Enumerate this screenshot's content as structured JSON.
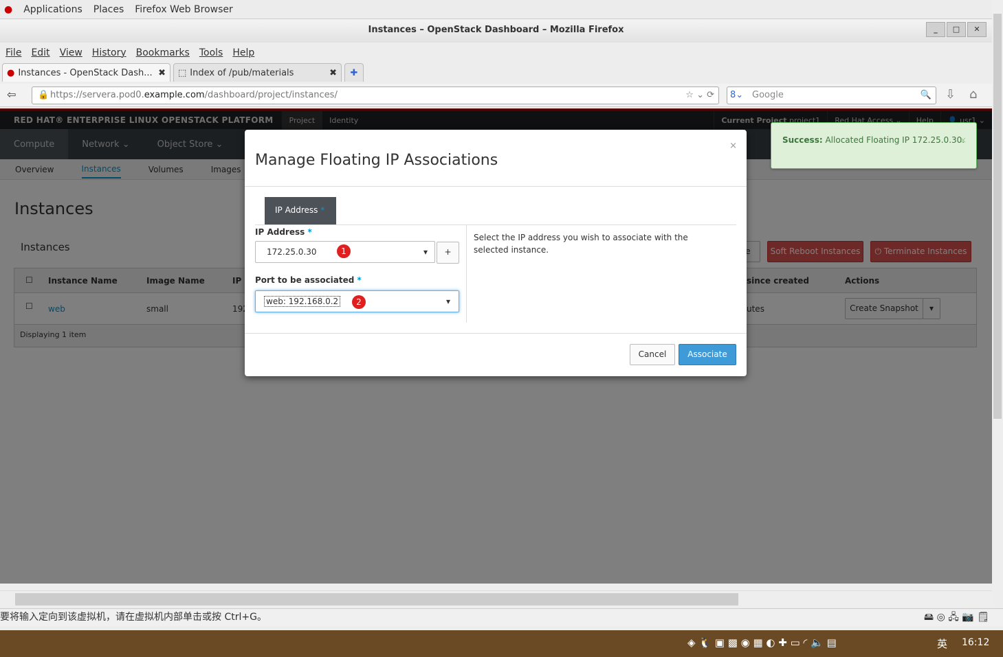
{
  "gnome": {
    "applications": "Applications",
    "places": "Places",
    "firefox": "Firefox Web Browser"
  },
  "window": {
    "title": "Instances – OpenStack Dashboard – Mozilla Firefox"
  },
  "menu": [
    "File",
    "Edit",
    "View",
    "History",
    "Bookmarks",
    "Tools",
    "Help"
  ],
  "tabs": [
    {
      "label": "Instances - OpenStack Dash..."
    },
    {
      "label": "Index of /pub/materials"
    }
  ],
  "url": {
    "pre": "https://servera.pod0.",
    "host": "example.com",
    "post": "/dashboard/project/instances/"
  },
  "search": {
    "placeholder": "Google"
  },
  "topbar": {
    "brand": "RED HAT® ENTERPRISE LINUX OPENSTACK PLATFORM",
    "project": "Project",
    "identity": "Identity",
    "current_label": "Current Project",
    "current_value": "project1",
    "access": "Red Hat Access ⌄",
    "help": "Help",
    "user": "usr1 ⌄"
  },
  "nav": [
    "Compute",
    "Network ⌄",
    "Object Store ⌄"
  ],
  "subnav": [
    "Overview",
    "Instances",
    "Volumes",
    "Images"
  ],
  "main": {
    "title": "Instances",
    "section": "Instances",
    "soft_reboot": "Soft Reboot Instances",
    "terminate": "Terminate Instances",
    "partial_btn": "e",
    "columns": [
      "Instance Name",
      "Image Name",
      "IP",
      "since created",
      "Actions"
    ],
    "row": {
      "name": "web",
      "image": "small",
      "ip": "192",
      "time": "utes",
      "action": "Create Snapshot"
    },
    "footer": "Displaying 1 item"
  },
  "modal": {
    "title": "Manage Floating IP Associations",
    "close": "×",
    "tab": "IP Address",
    "ip_label": "IP Address",
    "ip_value": "172.25.0.30",
    "add": "+",
    "port_label": "Port to be associated",
    "port_value": "web: 192.168.0.2",
    "required": "*",
    "help": "Select the IP address you wish to associate with the selected instance.",
    "cancel": "Cancel",
    "associate": "Associate",
    "badge1": "1",
    "badge2": "2"
  },
  "toast": {
    "strong": "Success:",
    "text": "Allocated Floating IP 172.25.0.30.",
    "close": "×"
  },
  "vm": {
    "status": "要将输入定向到该虚拟机，请在虚拟机内部单击或按 Ctrl+G。"
  },
  "taskbar": {
    "ime": "英",
    "clock": "16:12"
  },
  "colors": {
    "accent": "#0099d3",
    "primary": "#3f9ad8",
    "danger": "#d9534f",
    "success_bg": "#dff0d8"
  }
}
